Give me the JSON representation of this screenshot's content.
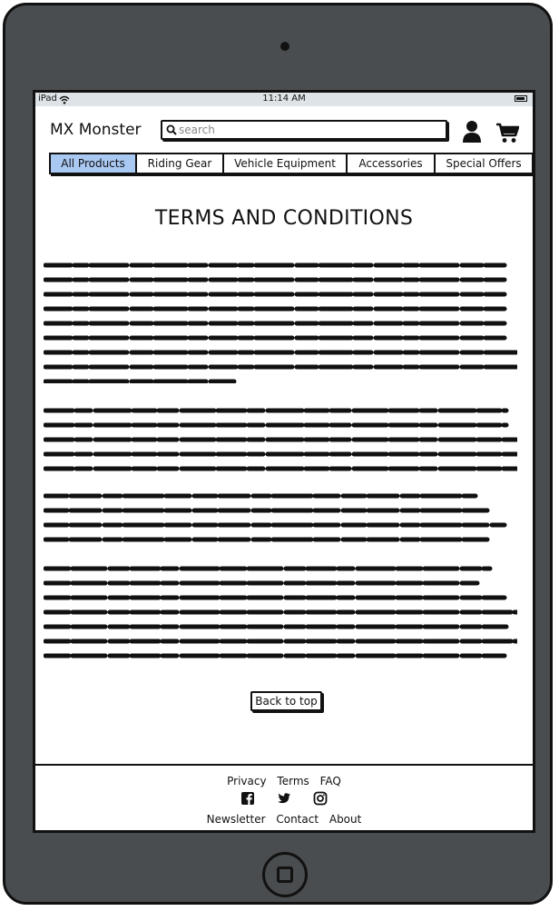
{
  "status_bar": {
    "carrier": "iPad",
    "time": "11:14 AM"
  },
  "header": {
    "brand": "MX Monster",
    "search": {
      "placeholder": "search",
      "value": ""
    }
  },
  "nav": {
    "tabs": [
      {
        "label": "All Products",
        "active": true
      },
      {
        "label": "Riding Gear",
        "active": false
      },
      {
        "label": "Vehicle Equipment",
        "active": false
      },
      {
        "label": "Accessories",
        "active": false
      },
      {
        "label": "Special Offers",
        "active": false
      }
    ]
  },
  "main": {
    "title": "TERMS AND CONDITIONS",
    "back_to_top": "Back to top"
  },
  "footer": {
    "links_top": [
      "Privacy",
      "Terms",
      "FAQ"
    ],
    "social_icons": [
      "facebook-icon",
      "twitter-icon",
      "instagram-icon"
    ],
    "links_bottom": [
      "Newsletter",
      "Contact",
      "About"
    ]
  },
  "colors": {
    "active_tab": "#a9c8f2",
    "device_body": "#4a4d4f",
    "status_bar": "#dde3e6"
  }
}
